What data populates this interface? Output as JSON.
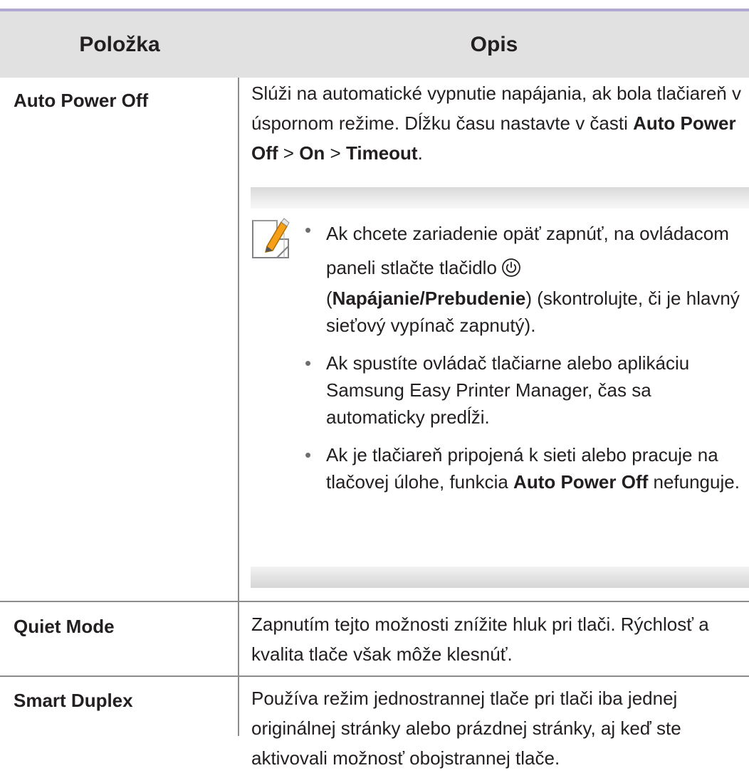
{
  "header": {
    "item": "Položka",
    "desc": "Opis"
  },
  "rows": [
    {
      "item": "Auto Power Off",
      "desc": {
        "t1": "Slúži na automatické vypnutie napájania, ak bola tlačiareň v úspornom režime. Dĺžku času nastavte v časti ",
        "b1": "Auto Power Off",
        "t2": " > ",
        "b2": "On",
        "t3": " > ",
        "b3": "Timeout",
        "t4": "."
      },
      "note": {
        "icon": "note-pencil-icon",
        "bullets": [
          {
            "t1": "Ak chcete zariadenie opäť zapnúť, na ovládacom paneli stlačte tlačidlo",
            "icon": "power-icon",
            "t2": "(",
            "b1": "Napájanie/Prebudenie",
            "t3": ") (skontrolujte, či je hlavný sieťový vypínač zapnutý)."
          },
          {
            "t1": "Ak spustíte ovládač tlačiarne alebo aplikáciu Samsung Easy Printer Manager, čas sa automaticky predĺži."
          },
          {
            "t1": "Ak je tlačiareň pripojená k sieti alebo pracuje na tlačovej úlohe, funkcia ",
            "b1": "Auto Power Off",
            "t2": " nefunguje."
          }
        ]
      }
    },
    {
      "item": "Quiet Mode",
      "desc": "Zapnutím tejto možnosti znížite hluk pri tlači. Rýchlosť a kvalita tlače však môže klesnúť."
    },
    {
      "item": "Smart Duplex",
      "desc": "Používa režim jednostrannej tlače pri tlači iba jednej originálnej stránky alebo prázdnej stránky, aj keď ste aktivovali možnosť obojstrannej tlače."
    }
  ],
  "colors": {
    "top_rule": "#b1a9d3",
    "header_bg": "#e1e1e1",
    "grid": "#8c8c8c",
    "text": "#231f20"
  }
}
